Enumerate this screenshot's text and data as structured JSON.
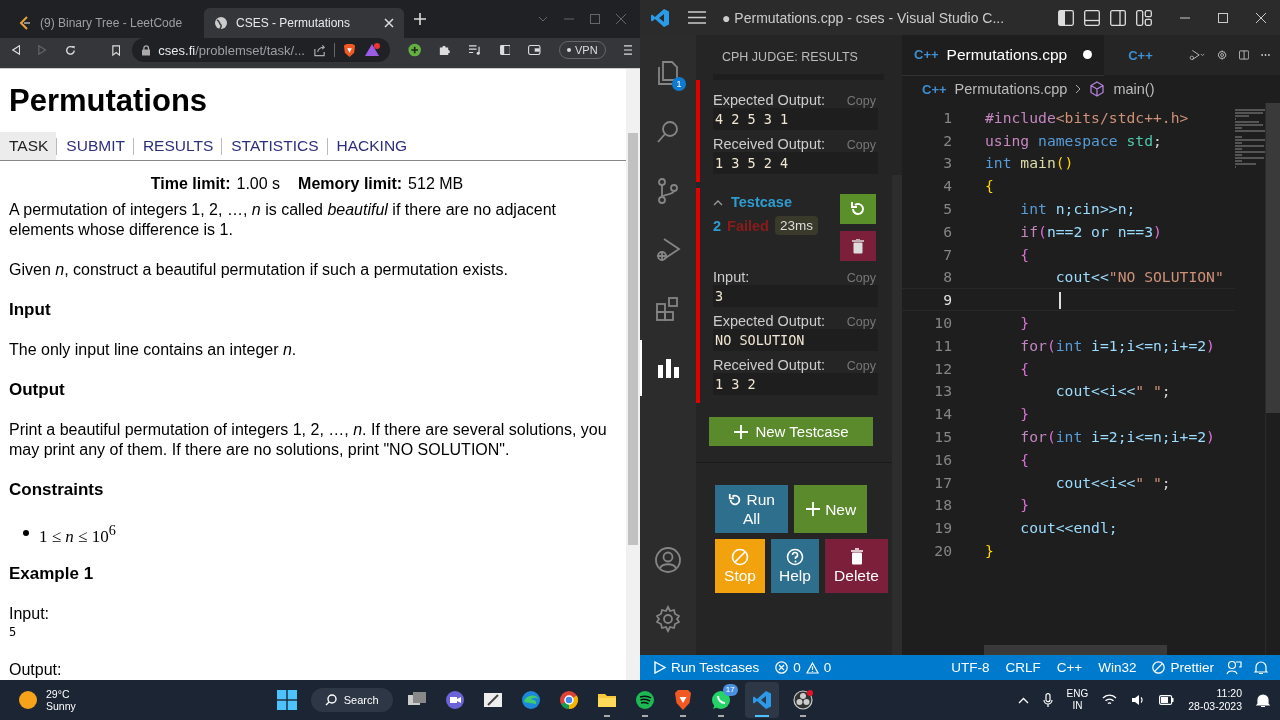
{
  "browser": {
    "tabs": [
      {
        "title": "(9) Binary Tree - LeetCode",
        "kind": "leetcode",
        "selected": false
      },
      {
        "title": "CSES - Permutations",
        "kind": "globe",
        "selected": true
      }
    ],
    "address": {
      "host": "cses.fi",
      "path": "/problemset/task/..."
    },
    "vpn": "VPN",
    "page": {
      "title": "Permutations",
      "nav": [
        {
          "label": "TASK",
          "selected": true
        },
        {
          "label": "SUBMIT",
          "selected": false
        },
        {
          "label": "RESULTS",
          "selected": false
        },
        {
          "label": "STATISTICS",
          "selected": false
        },
        {
          "label": "HACKING",
          "selected": false
        }
      ],
      "limits": [
        {
          "label": "Time limit:",
          "value": "1.00 s"
        },
        {
          "label": "Memory limit:",
          "value": "512 MB"
        }
      ],
      "content": [
        {
          "kind": "paragraph",
          "text": "A permutation of integers 1, 2, …, *n* is called *beautiful* if there are no adjacent elements whose difference is 1."
        },
        {
          "kind": "paragraph",
          "text": "Given *n*, construct a beautiful permutation if such a permutation exists."
        },
        {
          "kind": "heading",
          "text": "Input"
        },
        {
          "kind": "paragraph",
          "text": "The only input line contains an integer *n*."
        },
        {
          "kind": "heading",
          "text": "Output"
        },
        {
          "kind": "paragraph",
          "text": "Print a beautiful permutation of integers 1, 2, …, *n*. If there are several solutions, you may print any of them. If there are no solutions, print \"NO SOLUTION\"."
        },
        {
          "kind": "heading",
          "text": "Constraints"
        },
        {
          "kind": "bullet",
          "text": "1 ≤ *n* ≤ 10$^{6}$"
        },
        {
          "kind": "heading",
          "text": "Example 1"
        },
        {
          "kind": "label",
          "text": "Input:"
        },
        {
          "kind": "pre",
          "text": "5"
        },
        {
          "kind": "label",
          "text": "Output:"
        }
      ]
    }
  },
  "vscode": {
    "title": "● Permutations.cpp - cses - Visual Studio C...",
    "activity": [
      {
        "kind": "files",
        "badge": "1",
        "selected": false
      },
      {
        "kind": "search",
        "selected": false
      },
      {
        "kind": "git",
        "selected": false
      },
      {
        "kind": "debug",
        "selected": false
      },
      {
        "kind": "extensions",
        "selected": false
      },
      {
        "kind": "chart",
        "selected": true
      }
    ],
    "activity_bottom": [
      {
        "kind": "account"
      },
      {
        "kind": "settings"
      }
    ],
    "panel": {
      "title": "CPH JUDGE: RESULTS",
      "testcases": [
        {
          "passed": false,
          "fields": [
            {
              "label": "Expected Output:",
              "copy": "Copy",
              "value": "4 2 5 3 1"
            },
            {
              "label": "Received Output:",
              "copy": "Copy",
              "value": "1 3 5 2 4"
            }
          ]
        },
        {
          "passed": false,
          "header": {
            "label": "Testcase",
            "expanded": true,
            "number": "2",
            "verdict": "Failed",
            "time": "23ms"
          },
          "fields": [
            {
              "label": "Input:",
              "copy": "Copy",
              "value": "3"
            },
            {
              "label": "Expected Output:",
              "copy": "Copy",
              "value": "NO SOLUTION"
            },
            {
              "label": "Received Output:",
              "copy": "Copy",
              "value": "1 3 2"
            }
          ]
        }
      ],
      "new_testcase": "New Testcase",
      "actions": [
        {
          "kind": "run",
          "label": "Run All"
        },
        {
          "kind": "new",
          "label": "New"
        },
        {
          "kind": "stop",
          "label": "Stop"
        },
        {
          "kind": "help",
          "label": "Help"
        },
        {
          "kind": "delete",
          "label": "Delete"
        }
      ]
    },
    "editor": {
      "tabs": [
        {
          "icon": "C++",
          "title": "Permutations.cpp",
          "modified": true,
          "selected": true
        },
        {
          "icon": "C++",
          "selected": false
        }
      ],
      "breadcrumb": [
        {
          "icon": "C++",
          "text": "Permutations.cpp"
        },
        {
          "text": "main()"
        }
      ],
      "lines": [
        {
          "number": "1",
          "current": false,
          "tokens": [
            {
              "kind": "directive",
              "text": "#include"
            },
            {
              "kind": "str",
              "text": "<bits/stdc++.h>"
            }
          ]
        },
        {
          "number": "2",
          "current": false,
          "tokens": [
            {
              "kind": "control",
              "text": "using"
            },
            {
              "kind": "keyword",
              "text": " namespace"
            },
            {
              "kind": "type",
              "text": " std"
            },
            {
              "kind": "punct",
              "text": ";"
            }
          ]
        },
        {
          "number": "3",
          "current": false,
          "tokens": [
            {
              "kind": "keyword",
              "text": "int"
            },
            {
              "kind": "fn",
              "text": " main"
            },
            {
              "kind": "brace1",
              "text": "()"
            }
          ]
        },
        {
          "number": "4",
          "current": false,
          "tokens": [
            {
              "kind": "brace1",
              "text": "{"
            }
          ]
        },
        {
          "number": "5",
          "current": false,
          "tokens": [
            {
              "kind": "keyword",
              "text": "    int"
            },
            {
              "kind": "var",
              "text": " n;cin>>n;"
            }
          ]
        },
        {
          "number": "6",
          "current": false,
          "tokens": [
            {
              "kind": "control",
              "text": "    if"
            },
            {
              "kind": "brace2",
              "text": "("
            },
            {
              "kind": "var",
              "text": "n==2 or n==3"
            },
            {
              "kind": "brace2",
              "text": ")"
            }
          ]
        },
        {
          "number": "7",
          "current": false,
          "tokens": [
            {
              "kind": "brace2",
              "text": "    {"
            }
          ]
        },
        {
          "number": "8",
          "current": false,
          "tokens": [
            {
              "kind": "var",
              "text": "        cout<<"
            },
            {
              "kind": "str",
              "text": "\"NO SOLUTION\""
            }
          ]
        },
        {
          "number": "9",
          "current": true
        },
        {
          "number": "10",
          "current": false,
          "tokens": [
            {
              "kind": "brace2",
              "text": "    }"
            }
          ]
        },
        {
          "number": "11",
          "current": false,
          "tokens": [
            {
              "kind": "control",
              "text": "    for"
            },
            {
              "kind": "brace2",
              "text": "("
            },
            {
              "kind": "keyword",
              "text": "int"
            },
            {
              "kind": "var",
              "text": " i=1;i<=n;i+=2"
            },
            {
              "kind": "brace2",
              "text": ")"
            }
          ]
        },
        {
          "number": "12",
          "current": false,
          "tokens": [
            {
              "kind": "brace2",
              "text": "    {"
            }
          ]
        },
        {
          "number": "13",
          "current": false,
          "tokens": [
            {
              "kind": "var",
              "text": "        cout<<i<<"
            },
            {
              "kind": "str",
              "text": "\" \""
            },
            {
              "kind": "punct",
              "text": ";"
            }
          ]
        },
        {
          "number": "14",
          "current": false,
          "tokens": [
            {
              "kind": "brace2",
              "text": "    }"
            }
          ]
        },
        {
          "number": "15",
          "current": false,
          "tokens": [
            {
              "kind": "control",
              "text": "    for"
            },
            {
              "kind": "brace2",
              "text": "("
            },
            {
              "kind": "keyword",
              "text": "int"
            },
            {
              "kind": "var",
              "text": " i=2;i<=n;i+=2"
            },
            {
              "kind": "brace2",
              "text": ")"
            }
          ]
        },
        {
          "number": "16",
          "current": false,
          "tokens": [
            {
              "kind": "brace2",
              "text": "    {"
            }
          ]
        },
        {
          "number": "17",
          "current": false,
          "tokens": [
            {
              "kind": "var",
              "text": "        cout<<i<<"
            },
            {
              "kind": "str",
              "text": "\" \""
            },
            {
              "kind": "punct",
              "text": ";"
            }
          ]
        },
        {
          "number": "18",
          "current": false,
          "tokens": [
            {
              "kind": "brace2",
              "text": "    }"
            }
          ]
        },
        {
          "number": "19",
          "current": false,
          "tokens": [
            {
              "kind": "var",
              "text": "    cout<<endl;"
            }
          ]
        },
        {
          "number": "20",
          "current": false,
          "tokens": [
            {
              "kind": "brace1",
              "text": "}"
            }
          ]
        }
      ]
    },
    "status_bar": {
      "run": "Run Testcases",
      "errors": "0",
      "warnings": "0",
      "items": [
        "UTF-8",
        "CRLF",
        "C++",
        "Win32"
      ],
      "prettier": "Prettier"
    }
  },
  "taskbar": {
    "weather": {
      "temp": "29°C",
      "condition": "Sunny"
    },
    "search": "Search",
    "apps": [
      {
        "kind": "taskview",
        "running": false,
        "active": false
      },
      {
        "kind": "chat",
        "running": false,
        "active": false
      },
      {
        "kind": "snip",
        "running": false,
        "active": false
      },
      {
        "kind": "edge",
        "running": false,
        "active": false
      },
      {
        "kind": "chrome",
        "running": false,
        "active": false
      },
      {
        "kind": "folder",
        "running": true,
        "active": false
      },
      {
        "kind": "spotify",
        "running": true,
        "active": false
      },
      {
        "kind": "brave",
        "running": true,
        "active": false
      },
      {
        "kind": "whatsapp",
        "running": true,
        "active": false,
        "badge": "17"
      },
      {
        "kind": "vscode",
        "running": true,
        "active": true
      },
      {
        "kind": "obs",
        "running": true,
        "active": false
      }
    ],
    "lang": [
      "ENG",
      "IN"
    ],
    "time": "11:20",
    "date": "28-03-2023"
  }
}
